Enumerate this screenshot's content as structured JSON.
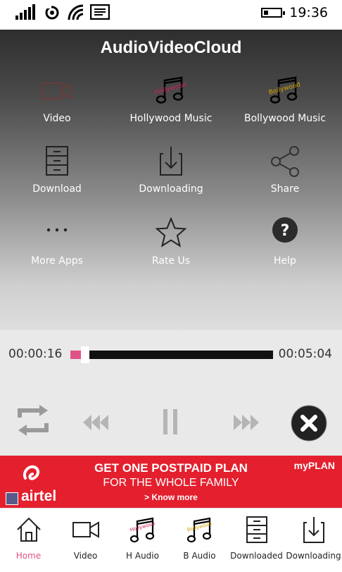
{
  "status_bar": {
    "time": "19:36",
    "icons": [
      "signal-icon",
      "sync-icon",
      "wifi-icon",
      "message-icon",
      "battery-icon"
    ]
  },
  "app": {
    "title": "AudioVideoCloud"
  },
  "tiles": [
    {
      "label": "Video",
      "icon": "video-camera-icon"
    },
    {
      "label": "Hollywood Music",
      "icon": "hollywood-music-note-icon",
      "badge": "Hollywood"
    },
    {
      "label": "Bollywood Music",
      "icon": "bollywood-music-note-icon",
      "badge": "Bollywood"
    },
    {
      "label": "Download",
      "icon": "file-cabinet-icon"
    },
    {
      "label": "Downloading",
      "icon": "download-arrow-icon"
    },
    {
      "label": "Share",
      "icon": "share-icon"
    },
    {
      "label": "More Apps",
      "icon": "more-dots-icon"
    },
    {
      "label": "Rate Us",
      "icon": "star-icon"
    },
    {
      "label": "Help",
      "icon": "help-icon"
    }
  ],
  "player": {
    "current_time": "00:00:16",
    "total_time": "00:05:04",
    "progress_fraction": 0.053,
    "controls": [
      "repeat-icon",
      "rewind-icon",
      "pause-icon",
      "fast-forward-icon",
      "close-icon"
    ]
  },
  "ad": {
    "headline": "GET ONE POSTPAID PLAN",
    "subline": "FOR THE WHOLE FAMILY",
    "cta": "> Know more",
    "tag": "myPLAN",
    "brand": "airtel"
  },
  "nav": {
    "items": [
      {
        "label": "Home",
        "icon": "home-icon",
        "active": true
      },
      {
        "label": "Video",
        "icon": "video-camera-icon"
      },
      {
        "label": "H Audio",
        "icon": "hollywood-music-note-icon"
      },
      {
        "label": "B Audio",
        "icon": "bollywood-music-note-icon"
      },
      {
        "label": "Downloaded",
        "icon": "file-cabinet-icon"
      },
      {
        "label": "Downloading",
        "icon": "download-arrow-icon"
      }
    ]
  },
  "colors": {
    "accent": "#e05285",
    "ad_red": "#e4202e",
    "panel_dark": "#2e2e2e",
    "player_bg": "#e9e9e9",
    "close_button": "#222222"
  }
}
